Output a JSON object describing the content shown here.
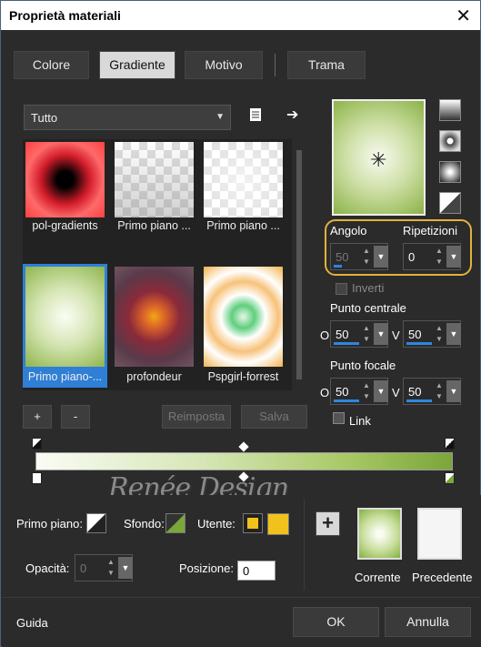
{
  "window": {
    "title": "Proprietà materiali",
    "close_glyph": "✕"
  },
  "tabs": [
    {
      "label": "Colore",
      "active": false
    },
    {
      "label": "Gradiente",
      "active": true
    },
    {
      "label": "Motivo",
      "active": false
    },
    {
      "label": "Trama",
      "active": false
    }
  ],
  "category": {
    "selected": "Tutto"
  },
  "icons": {
    "new_doc": "document-icon",
    "arrow": "arrow-right-icon"
  },
  "gallery": {
    "items": [
      {
        "caption": "pol-gradients"
      },
      {
        "caption": "Primo piano ..."
      },
      {
        "caption": "Primo piano ..."
      },
      {
        "caption": "Primo piano-..."
      },
      {
        "caption": "profondeur"
      },
      {
        "caption": "Pspgirl-forrest"
      }
    ],
    "selected_index": 3
  },
  "gallery_buttons": {
    "add": "+",
    "remove": "-",
    "reset": "Reimposta",
    "save": "Salva"
  },
  "angle": {
    "label": "Angolo",
    "value": "50"
  },
  "repeats": {
    "label": "Ripetizioni",
    "value": "0"
  },
  "invert": {
    "label": "Inverti",
    "checked": false
  },
  "center": {
    "label": "Punto centrale",
    "o_label": "O",
    "o_value": "50",
    "v_label": "V",
    "v_value": "50"
  },
  "focal": {
    "label": "Punto focale",
    "o_label": "O",
    "o_value": "50",
    "v_label": "V",
    "v_value": "50"
  },
  "link": {
    "label": "Link",
    "checked": false
  },
  "watermark": "Renée Design",
  "lower": {
    "foreground_label": "Primo piano:",
    "background_label": "Sfondo:",
    "user_label": "Utente:",
    "user_color": "#f1c21b",
    "opacity_label": "Opacità:",
    "opacity_value": "0",
    "position_label": "Posizione:",
    "position_value": "0",
    "add_glyph": "+",
    "current_label": "Corrente",
    "previous_label": "Precedente"
  },
  "footer": {
    "help": "Guida",
    "ok": "OK",
    "cancel": "Annulla"
  },
  "colors": {
    "accent": "#2f7fd6",
    "highlight": "#e3b23c",
    "gradient_end": "#7aa63a"
  }
}
